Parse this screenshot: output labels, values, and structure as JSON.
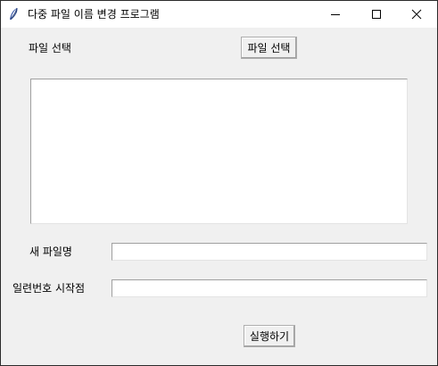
{
  "window": {
    "title": "다중 파일 이름 변경 프로그램",
    "app_icon": "feather-icon",
    "minimize_icon": "minimize-icon",
    "maximize_icon": "maximize-icon",
    "close_icon": "close-icon"
  },
  "file_select": {
    "label": "파일 선택",
    "button_label": "파일 선택"
  },
  "file_list": {
    "items": []
  },
  "new_name": {
    "label": "새 파일명",
    "value": ""
  },
  "serial_start": {
    "label": "일련번호 시작점",
    "value": ""
  },
  "run_button": {
    "label": "실행하기"
  }
}
